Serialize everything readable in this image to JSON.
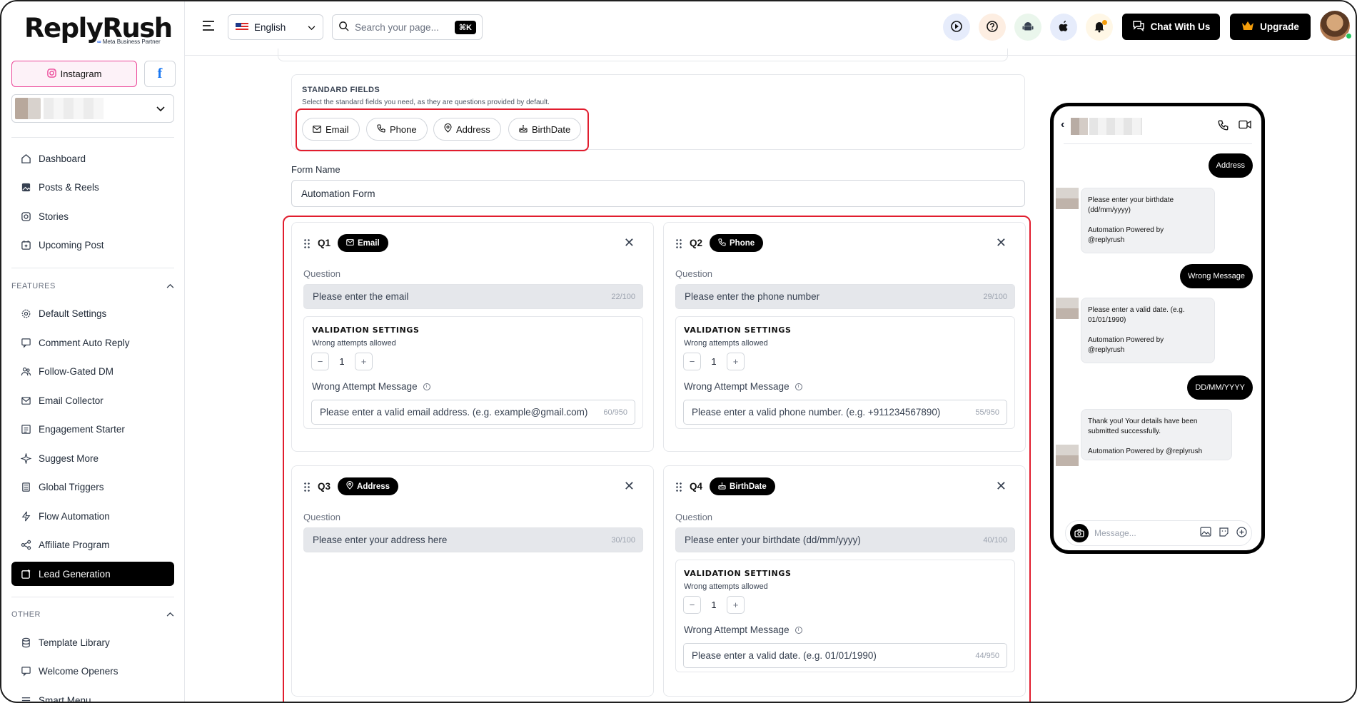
{
  "brand": {
    "name": "ReplyRush",
    "partner": "Meta Business Partner"
  },
  "account": {
    "instagram_label": "Instagram",
    "facebook_label": "f"
  },
  "sidebar": {
    "main_items": [
      {
        "label": "Dashboard",
        "icon": "home-icon"
      },
      {
        "label": "Posts & Reels",
        "icon": "image-icon"
      },
      {
        "label": "Stories",
        "icon": "instagram-icon"
      },
      {
        "label": "Upcoming Post",
        "icon": "calendar-plus-icon"
      }
    ],
    "features_label": "FEATURES",
    "feature_items": [
      {
        "label": "Default Settings",
        "icon": "gear-icon"
      },
      {
        "label": "Comment Auto Reply",
        "icon": "comment-icon"
      },
      {
        "label": "Follow-Gated DM",
        "icon": "users-icon"
      },
      {
        "label": "Email Collector",
        "icon": "mail-icon"
      },
      {
        "label": "Engagement Starter",
        "icon": "list-icon"
      },
      {
        "label": "Suggest More",
        "icon": "sparkle-icon"
      },
      {
        "label": "Global Triggers",
        "icon": "list-icon"
      },
      {
        "label": "Flow Automation",
        "icon": "bolt-icon"
      },
      {
        "label": "Affiliate Program",
        "icon": "share-icon"
      },
      {
        "label": "Lead Generation",
        "icon": "calendar-plus-icon",
        "active": true
      }
    ],
    "other_label": "OTHER",
    "other_items": [
      {
        "label": "Template Library",
        "icon": "database-icon"
      },
      {
        "label": "Welcome Openers",
        "icon": "comment-icon"
      },
      {
        "label": "Smart Menu",
        "icon": "menu-icon"
      }
    ]
  },
  "topbar": {
    "language": "English",
    "search_placeholder": "Search your page...",
    "shortcut": "⌘K",
    "chat_button": "Chat With Us",
    "upgrade_button": "Upgrade"
  },
  "standard_fields": {
    "title": "STANDARD FIELDS",
    "description": "Select the standard fields you need, as they are questions provided by default.",
    "chips": [
      "Email",
      "Phone",
      "Address",
      "BirthDate"
    ]
  },
  "form": {
    "name_label": "Form Name",
    "name_value": "Automation Form"
  },
  "questions": [
    {
      "num": "Q1",
      "tag": "Email",
      "question_label": "Question",
      "question": "Please enter the email",
      "count": "22/100",
      "validation": {
        "title": "VALIDATION SETTINGS",
        "attempts_label": "Wrong attempts allowed",
        "attempts": "1",
        "message_label": "Wrong Attempt Message",
        "message": "Please enter a valid email address. (e.g. example@gmail.com)",
        "message_count": "60/950"
      }
    },
    {
      "num": "Q2",
      "tag": "Phone",
      "question_label": "Question",
      "question": "Please enter the phone number",
      "count": "29/100",
      "validation": {
        "title": "VALIDATION SETTINGS",
        "attempts_label": "Wrong attempts allowed",
        "attempts": "1",
        "message_label": "Wrong Attempt Message",
        "message": "Please enter a valid phone number. (e.g. +911234567890)",
        "message_count": "55/950"
      }
    },
    {
      "num": "Q3",
      "tag": "Address",
      "question_label": "Question",
      "question": "Please enter your address here",
      "count": "30/100"
    },
    {
      "num": "Q4",
      "tag": "BirthDate",
      "question_label": "Question",
      "question": "Please enter your birthdate (dd/mm/yyyy)",
      "count": "40/100",
      "validation": {
        "title": "VALIDATION SETTINGS",
        "attempts_label": "Wrong attempts allowed",
        "attempts": "1",
        "message_label": "Wrong Attempt Message",
        "message": "Please enter a valid date. (e.g. 01/01/1990)",
        "message_count": "44/950"
      }
    }
  ],
  "preview": {
    "msg_out_1": "Address",
    "msg_in_1": {
      "line1": "Please enter your birthdate",
      "line2": "(dd/mm/yyyy)",
      "line3": "Automation Powered by",
      "line4": "@replyrush"
    },
    "msg_out_2": "Wrong Message",
    "msg_in_2": {
      "line1": "Please enter a valid date. (e.g.",
      "line2": "01/01/1990)",
      "line3": "Automation Powered by",
      "line4": "@replyrush"
    },
    "msg_out_3": "DD/MM/YYYY",
    "msg_in_3": {
      "line1": "Thank you! Your details have been",
      "line2": "submitted successfully.",
      "line3": "Automation Powered by @replyrush"
    },
    "compose_placeholder": "Message..."
  }
}
